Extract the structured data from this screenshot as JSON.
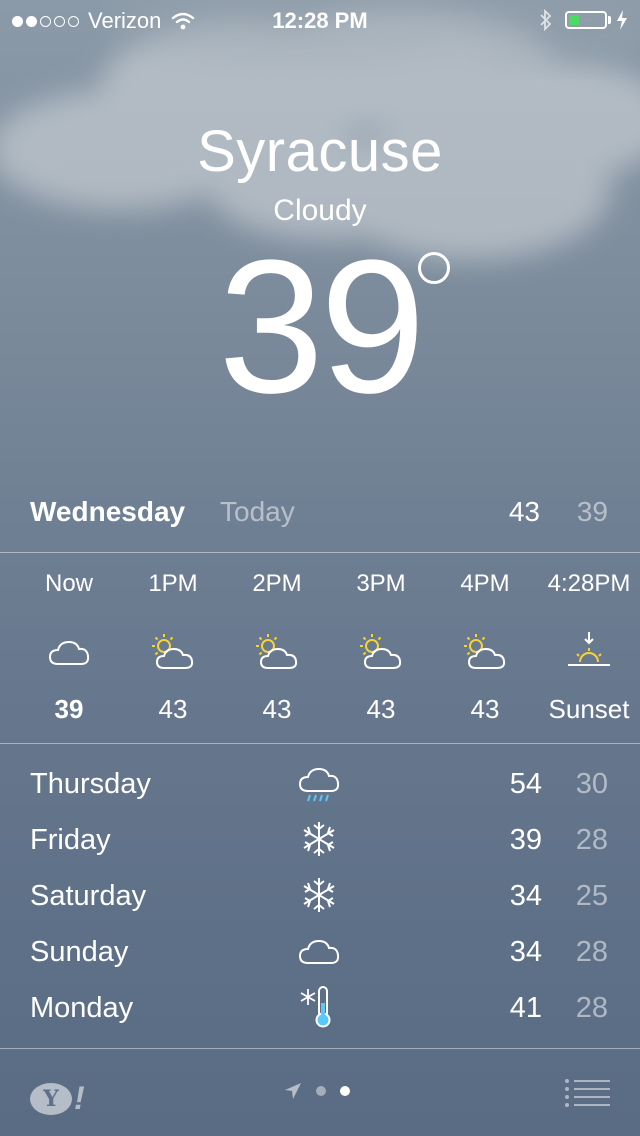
{
  "status_bar": {
    "signal_bars": 2,
    "signal_total": 5,
    "carrier": "Verizon",
    "time": "12:28 PM",
    "battery_level": 0.3,
    "battery_color": "#4cd964"
  },
  "location": {
    "city": "Syracuse",
    "condition": "Cloudy",
    "temperature": "39"
  },
  "today": {
    "day": "Wednesday",
    "label": "Today",
    "high": "43",
    "low": "39"
  },
  "hourly": [
    {
      "time": "Now",
      "icon": "cloud-icon",
      "temp": "39",
      "bold": true
    },
    {
      "time": "1PM",
      "icon": "partly-sunny-icon",
      "temp": "43"
    },
    {
      "time": "2PM",
      "icon": "partly-sunny-icon",
      "temp": "43"
    },
    {
      "time": "3PM",
      "icon": "partly-sunny-icon",
      "temp": "43"
    },
    {
      "time": "4PM",
      "icon": "partly-sunny-icon",
      "temp": "43"
    },
    {
      "time": "4:28PM",
      "icon": "sunset-icon",
      "temp": "Sunset"
    }
  ],
  "daily": [
    {
      "day": "Thursday",
      "icon": "rain-icon",
      "high": "54",
      "low": "30"
    },
    {
      "day": "Friday",
      "icon": "snowflake-icon",
      "high": "39",
      "low": "28"
    },
    {
      "day": "Saturday",
      "icon": "snowflake-icon",
      "high": "34",
      "low": "25"
    },
    {
      "day": "Sunday",
      "icon": "cloud-icon",
      "high": "34",
      "low": "28"
    },
    {
      "day": "Monday",
      "icon": "cold-thermometer-icon",
      "high": "41",
      "low": "28"
    }
  ],
  "footer": {
    "yahoo_logo": "Y!",
    "pages": 2,
    "active_page": 1,
    "sun_color": "#f5d23a",
    "rain_color": "#5ac8fa"
  }
}
